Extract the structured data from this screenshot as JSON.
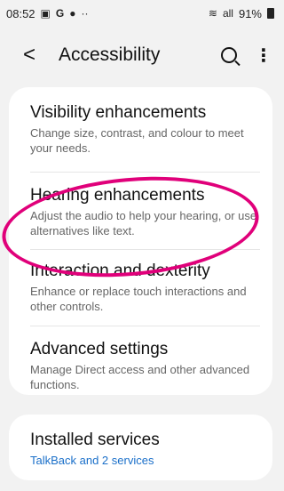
{
  "status": {
    "time": "08:52",
    "notif_icons": [
      "gallery-icon",
      "google-icon",
      "vpn-icon"
    ],
    "overflow_dots": "··",
    "signal_text": "all",
    "battery": "91%"
  },
  "header": {
    "title": "Accessibility",
    "back_icon": "back-arrow-icon",
    "search_icon": "search-icon",
    "more_icon": "more-options-icon"
  },
  "items": [
    {
      "title": "Visibility enhancements",
      "subtitle": "Change size, contrast, and colour to meet your needs."
    },
    {
      "title": "Hearing enhancements",
      "subtitle": "Adjust the audio to help your hearing, or use alternatives like text."
    },
    {
      "title": "Interaction and dexterity",
      "subtitle": "Enhance or replace touch interactions and other controls."
    },
    {
      "title": "Advanced settings",
      "subtitle": "Manage Direct access and other advanced functions."
    }
  ],
  "installed": {
    "title": "Installed services",
    "subtitle": "TalkBack and 2 services"
  },
  "annotation_color": "#e0007a",
  "link_color": "#1a6fc9"
}
